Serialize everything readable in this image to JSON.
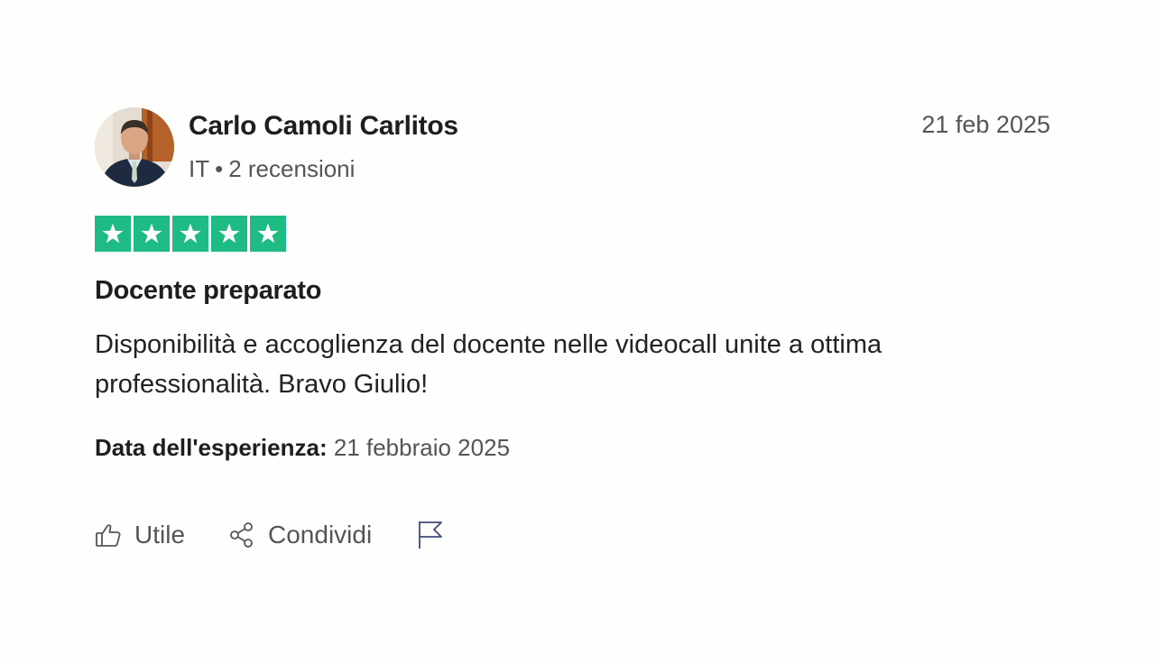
{
  "review": {
    "author": {
      "name": "Carlo Camoli Carlitos",
      "country": "IT",
      "separator": "•",
      "reviews_count": "2 recensioni"
    },
    "date": "21 feb 2025",
    "rating": {
      "stars": 5,
      "max": 5,
      "color": "#1ebb84"
    },
    "title": "Docente preparato",
    "body": "Disponibilità e accoglienza del docente nelle videocall unite a ottima professionalità. Bravo Giulio!",
    "experience": {
      "label": "Data dell'esperienza:",
      "value": "21 febbraio 2025"
    }
  },
  "actions": {
    "like": {
      "label": "Utile",
      "icon": "thumbs-up-icon"
    },
    "share": {
      "label": "Condividi",
      "icon": "share-icon"
    },
    "report": {
      "icon": "flag-icon"
    }
  }
}
